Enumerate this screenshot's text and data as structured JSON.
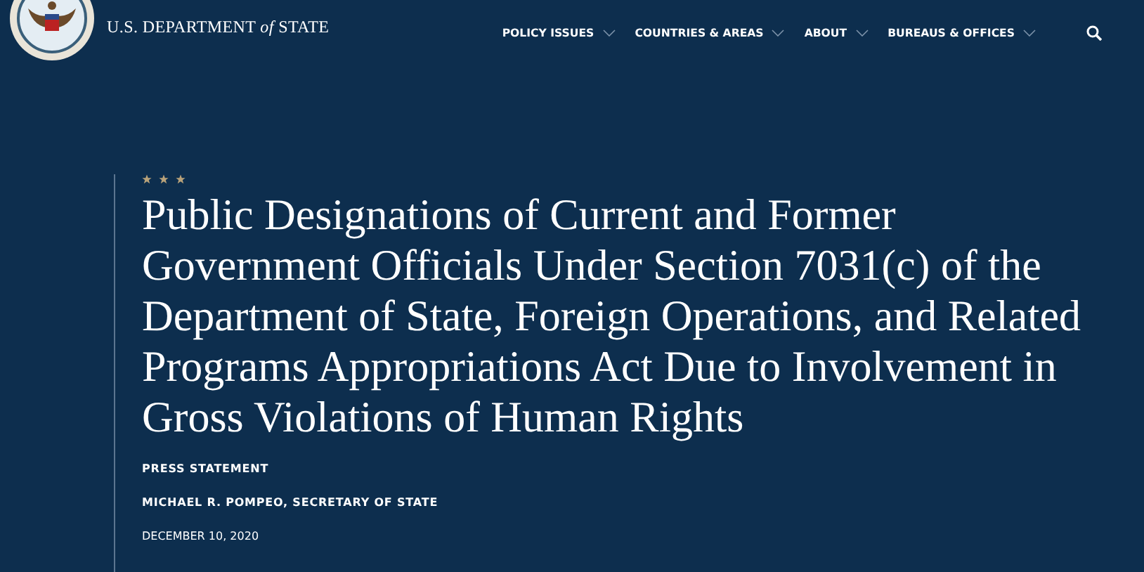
{
  "header": {
    "site_name": "U.S. DEPARTMENT *of* STATE",
    "nav": [
      {
        "label": "POLICY ISSUES",
        "has_dropdown": true
      },
      {
        "label": "COUNTRIES & AREAS",
        "has_dropdown": true
      },
      {
        "label": "ABOUT",
        "has_dropdown": true
      },
      {
        "label": "BUREAUS & OFFICES",
        "has_dropdown": true
      }
    ]
  },
  "article": {
    "title": "Public Designations of Current and Former Government Officials Under Section 7031(c) of the Department of State, Foreign Operations, and Related Programs Appropriations Act Due to Involvement in Gross Violations of Human Rights",
    "type": "PRESS STATEMENT",
    "author": "MICHAEL R. POMPEO, SECRETARY OF STATE",
    "date": "DECEMBER 10, 2020"
  }
}
